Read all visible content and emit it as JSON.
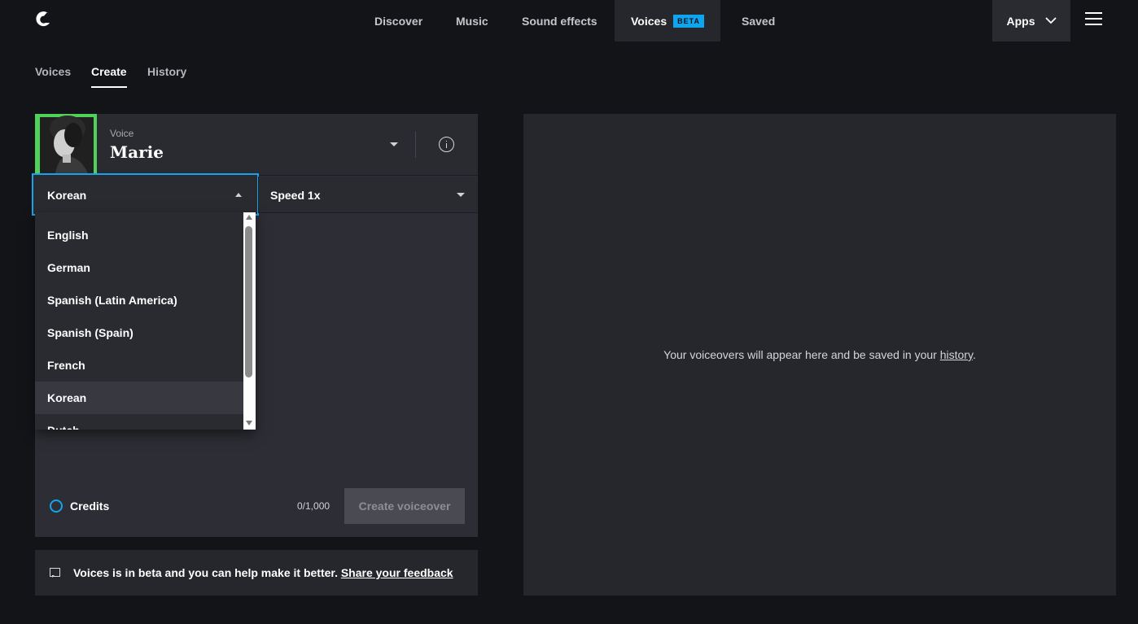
{
  "nav": {
    "items": [
      {
        "label": "Discover"
      },
      {
        "label": "Music"
      },
      {
        "label": "Sound effects"
      },
      {
        "label": "Voices",
        "badge": "BETA",
        "active": true
      },
      {
        "label": "Saved"
      }
    ],
    "apps_label": "Apps"
  },
  "subtabs": [
    {
      "label": "Voices"
    },
    {
      "label": "Create",
      "active": true
    },
    {
      "label": "History"
    }
  ],
  "voice": {
    "label": "Voice",
    "name": "Marie"
  },
  "language": {
    "selected": "Korean",
    "options": [
      "English",
      "German",
      "Spanish (Latin America)",
      "Spanish (Spain)",
      "French",
      "Korean",
      "Dutch"
    ]
  },
  "speed": {
    "selected": "Speed 1x"
  },
  "footer": {
    "credits_label": "Credits",
    "counter": "0/1,000",
    "create_label": "Create voiceover"
  },
  "feedback": {
    "text": "Voices is in beta and you can help make it better.",
    "link": "Share your feedback"
  },
  "output": {
    "message": "Your voiceovers will appear here and be saved in your",
    "link": "history",
    "suffix": "."
  },
  "colors": {
    "accent": "#17a3ec",
    "avatar_bg": "#4fd15a",
    "background": "#131418"
  },
  "icons": [
    "logo-icon",
    "chevron-down-icon",
    "hamburger-icon",
    "info-icon",
    "credits-circle-icon",
    "feedback-icon"
  ]
}
